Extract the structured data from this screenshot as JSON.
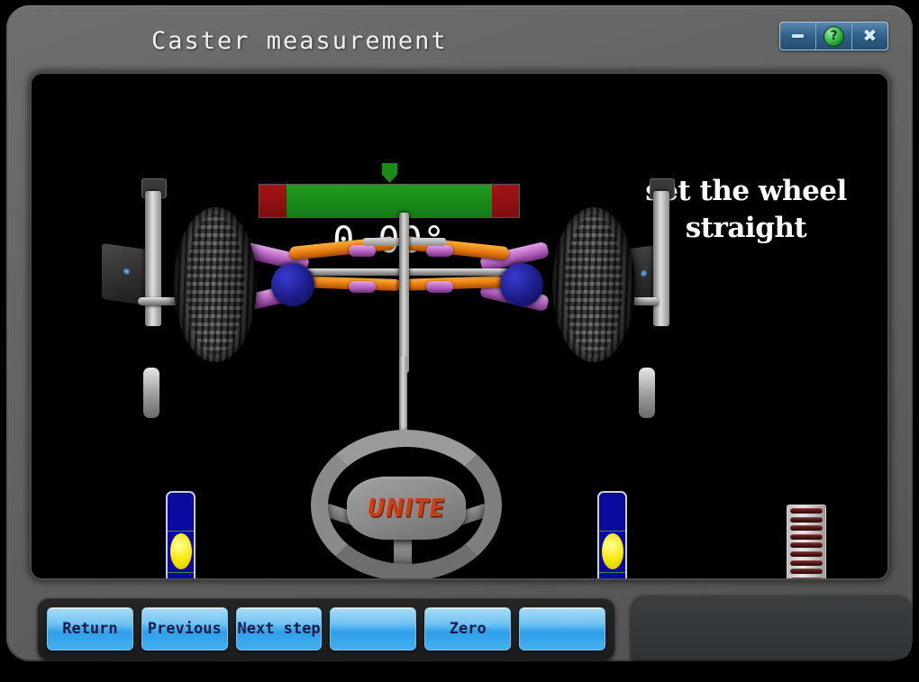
{
  "window": {
    "title": "Caster measurement",
    "controls": [
      {
        "name": "minimize",
        "glyph": ""
      },
      {
        "name": "help",
        "glyph": "?"
      },
      {
        "name": "close",
        "glyph": "✖"
      }
    ]
  },
  "display": {
    "gauge": {
      "value": "0.00°",
      "pointer_position_pct": 50,
      "green_color": "#1f9c1f",
      "red_color": "#a51414"
    },
    "instruction_line1": "set the wheel",
    "instruction_line2": "straight",
    "steering_wheel_logo": "UNITE",
    "left_level_indicator": {
      "name": "left-level-bubble",
      "bubble_color": "#f6e800",
      "body_color": "#0a0aa0"
    },
    "right_level_indicator": {
      "name": "right-level-bubble",
      "bubble_color": "#f6e800",
      "body_color": "#0a0aa0"
    },
    "ladder_scale": {
      "rungs": 11,
      "rung_color": "#4c1414"
    }
  },
  "toolbar": {
    "buttons": [
      {
        "label": "Return"
      },
      {
        "label": "Previous"
      },
      {
        "label": "Next step"
      },
      {
        "label": ""
      },
      {
        "label": "Zero"
      },
      {
        "label": ""
      }
    ]
  }
}
